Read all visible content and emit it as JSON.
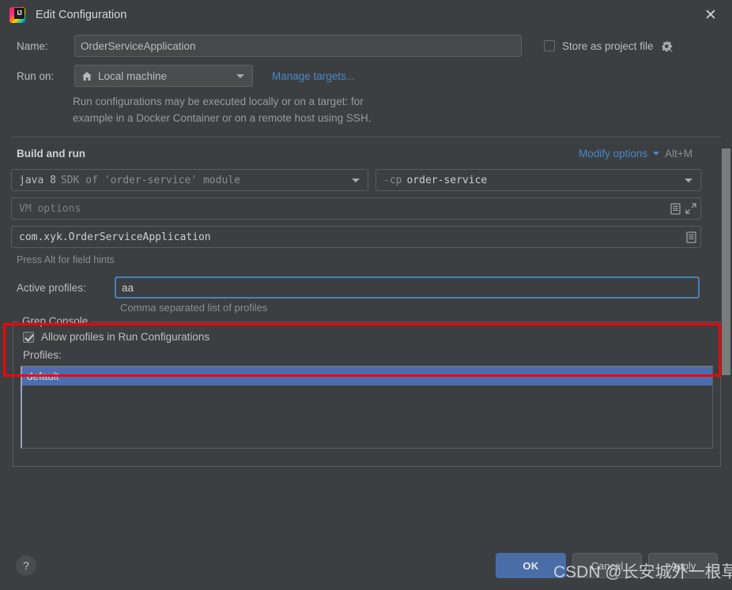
{
  "window": {
    "title": "Edit Configuration",
    "logo_icon": "intellij-idea-logo",
    "close_icon": "close-icon"
  },
  "form": {
    "name_label": "Name:",
    "name_value": "OrderServiceApplication",
    "store_as_project_file_label": "Store as project file",
    "store_as_project_file_checked": false,
    "store_gear_icon": "gear-dropdown-icon",
    "run_on_label": "Run on:",
    "run_on_value": "Local machine",
    "run_on_icon": "home-icon",
    "manage_targets_link": "Manage targets...",
    "targets_hint_line1": "Run configurations may be executed locally or on a target: for",
    "targets_hint_line2": "example in a Docker Container or on a remote host using SSH."
  },
  "build_and_run": {
    "section_title": "Build and run",
    "modify_options_label": "Modify options",
    "modify_options_shortcut": "Alt+M",
    "sdk_prefix": "java 8",
    "sdk_suffix": "SDK of 'order-service' module",
    "cp_prefix": "-cp",
    "cp_suffix": "order-service",
    "vm_options_placeholder": "VM options",
    "vm_options_value": "",
    "main_class_value": "com.xyk.OrderServiceApplication",
    "field_hint": "Press Alt for field hints",
    "expand_icon": "expand-icon",
    "document_icon": "document-icon"
  },
  "active_profiles": {
    "label": "Active profiles:",
    "value": "aa",
    "hint": "Comma separated list of profiles"
  },
  "grep_console": {
    "legend": "Grep Console",
    "allow_profiles_label": "Allow profiles in Run Configurations",
    "allow_profiles_checked": true,
    "profiles_label": "Profiles:",
    "profiles": [
      {
        "name": "default",
        "selected": true
      }
    ]
  },
  "footer": {
    "help_label": "?",
    "ok_label": "OK",
    "cancel_label": "Cancel",
    "apply_label": "Apply"
  },
  "watermark": {
    "text": "CSDN @长安城外一根草"
  },
  "colors": {
    "dialog_bg": "#3c3f41",
    "accent_blue": "#4a88c7",
    "primary_button": "#4a6da7",
    "selection_blue": "#4b6eaf",
    "focus_border": "#4a80b5",
    "annotation_red": "#ff0000"
  }
}
